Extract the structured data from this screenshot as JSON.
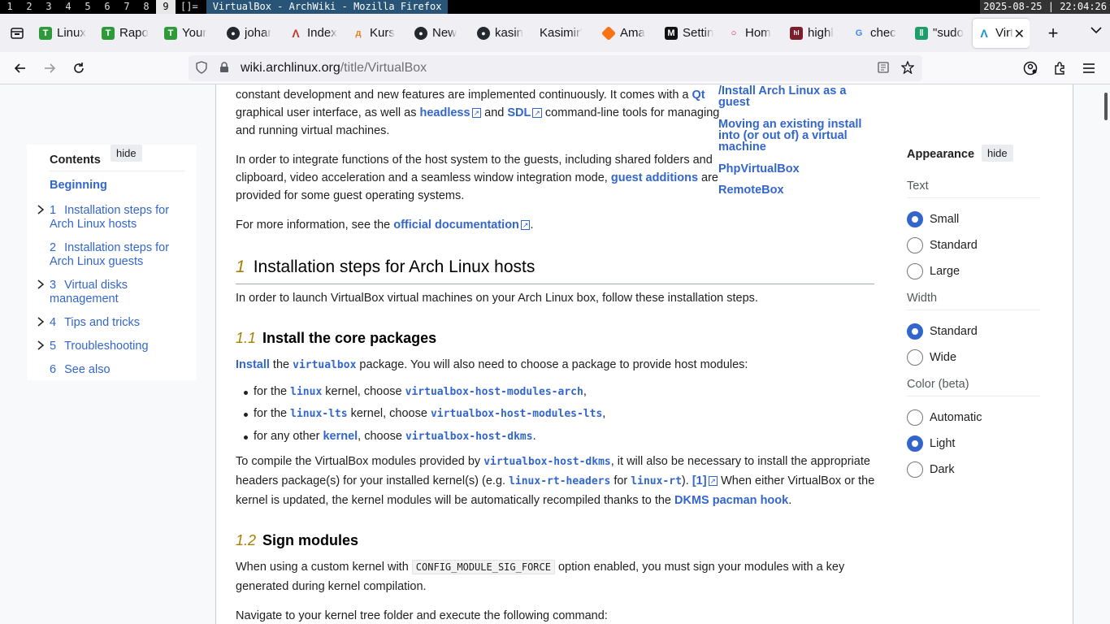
{
  "wm": {
    "workspaces": [
      "1",
      "2",
      "3",
      "4",
      "5",
      "6",
      "7",
      "8",
      "9"
    ],
    "active_workspace": "9",
    "layout": "[]=",
    "window_title": "VirtualBox - ArchWiki - Mozilla Firefox",
    "clock": "2025-08-25 | 22:04:26"
  },
  "tabs": [
    {
      "title": "Linux",
      "fav": "T",
      "color": "#2e9a3a"
    },
    {
      "title": "Rapo",
      "fav": "T",
      "color": "#2e9a3a"
    },
    {
      "title": "Your",
      "fav": "T",
      "color": "#2e9a3a"
    },
    {
      "title": "johar",
      "fav": "github-icon",
      "color": "#24292f"
    },
    {
      "title": "Index",
      "fav": "arch-icon",
      "color": "#c0392b"
    },
    {
      "title": "Kurs",
      "fav": "kurs-icon",
      "color": "#e67e22"
    },
    {
      "title": "New",
      "fav": "github-icon",
      "color": "#24292f"
    },
    {
      "title": "kasin",
      "fav": "github-icon",
      "color": "#24292f"
    },
    {
      "title": "Kasimir'",
      "fav": "",
      "color": "#ffffff"
    },
    {
      "title": "Ama",
      "fav": "box-icon",
      "color": "#f97316"
    },
    {
      "title": "Settin",
      "fav": "M",
      "color": "#111111"
    },
    {
      "title": "Hom",
      "fav": "O",
      "color": "#d6003a"
    },
    {
      "title": "highl",
      "fav": "hl",
      "color": "#7a1f2b"
    },
    {
      "title": "chec",
      "fav": "G",
      "color": "#4285f4"
    },
    {
      "title": "\"sudo",
      "fav": "confluence-icon",
      "color": "#1f9e6b"
    },
    {
      "title": "Virt",
      "fav": "A",
      "color": "#1793d1",
      "active": true
    }
  ],
  "url": {
    "host": "wiki.archlinux.org",
    "path": "/title/VirtualBox"
  },
  "toc": {
    "title": "Contents",
    "hide": "hide",
    "items": [
      {
        "num": "",
        "label": "Beginning",
        "bold": true
      },
      {
        "num": "1",
        "label": "Installation steps for",
        "label2": "Arch Linux hosts",
        "chev": true
      },
      {
        "num": "2",
        "label": "Installation steps for",
        "label2": "Arch Linux guests"
      },
      {
        "num": "3",
        "label": "Virtual disks",
        "label2": "management",
        "chev": true
      },
      {
        "num": "4",
        "label": "Tips and tricks",
        "chev": true
      },
      {
        "num": "5",
        "label": "Troubleshooting",
        "chev": true
      },
      {
        "num": "6",
        "label": "See also"
      }
    ]
  },
  "see_also": [
    "/Install Arch Linux as a",
    "guest",
    "Moving an existing install",
    "into (or out of) a virtual",
    "machine",
    "PhpVirtualBox",
    "RemoteBox"
  ],
  "intro": {
    "l1_a": "constant development and new features are implemented continuously. It comes with a ",
    "l1_qt": "Qt",
    "l2_a": "graphical user interface, as well as ",
    "l2_headless": "headless",
    "l2_b": " and ",
    "l2_sdl": "SDL",
    "l2_c": " command-line tools for managing",
    "l3": "and running virtual machines.",
    "p2_l1": "In order to integrate functions of the host system to the guests, including shared folders and",
    "p2_l2_a": "clipboard, video acceleration and a seamless window integration mode, ",
    "p2_l2_link": "guest additions",
    "p2_l2_b": " are",
    "p2_l3": "provided for some guest operating systems.",
    "p3_a": "For more information, see the ",
    "p3_link": "official documentation",
    "p3_b": "."
  },
  "section1": {
    "num": "1",
    "title": "Installation steps for Arch Linux hosts",
    "text": "In order to launch VirtualBox virtual machines on your Arch Linux box, follow these installation steps."
  },
  "section11": {
    "num": "1.1",
    "title": "Install the core packages",
    "l_install": "Install",
    "l_a": " the ",
    "l_pkg": "virtualbox",
    "l_b": " package. You will also need to choose a package to provide host modules:",
    "bullets": [
      {
        "a": "for the ",
        "code": "linux",
        "b": " kernel, choose ",
        "code2": "virtualbox-host-modules-arch",
        "c": ","
      },
      {
        "a": "for the ",
        "code": "linux-lts",
        "b": " kernel, choose ",
        "code2": "virtualbox-host-modules-lts",
        "c": ","
      },
      {
        "a": "for any other ",
        "link": "kernel",
        "b": ", choose ",
        "code2": "virtualbox-host-dkms",
        "c": "."
      }
    ],
    "p_l1_a": "To compile the VirtualBox modules provided by ",
    "p_l1_code": "virtualbox-host-dkms",
    "p_l1_b": ", it will also be necessary to install the appropriate",
    "p_l2_a": "headers package(s) for your installed kernel(s) (e.g. ",
    "p_l2_code": "linux-rt-headers",
    "p_l2_b": " for ",
    "p_l2_code2": "linux-rt",
    "p_l2_c": "). ",
    "p_l2_ref": "[1]",
    "p_l2_d": " When either VirtualBox or the",
    "p_l3_a": "kernel is updated, the kernel modules will be automatically recompiled thanks to the ",
    "p_l3_link": "DKMS pacman hook",
    "p_l3_b": "."
  },
  "section12": {
    "num": "1.2",
    "title": "Sign modules",
    "l1_a": "When using a custom kernel with ",
    "l1_code": "CONFIG_MODULE_SIG_FORCE",
    "l1_b": " option enabled, you must sign your modules with a key",
    "l2": "generated during kernel compilation.",
    "l3": "Navigate to your kernel tree folder and execute the following command:"
  },
  "appearance": {
    "title": "Appearance",
    "hide": "hide",
    "text_label": "Text",
    "text_opts": [
      "Small",
      "Standard",
      "Large"
    ],
    "text_sel": 0,
    "width_label": "Width",
    "width_opts": [
      "Standard",
      "Wide"
    ],
    "width_sel": 0,
    "color_label": "Color (beta)",
    "color_opts": [
      "Automatic",
      "Light",
      "Dark"
    ],
    "color_sel": 1
  }
}
